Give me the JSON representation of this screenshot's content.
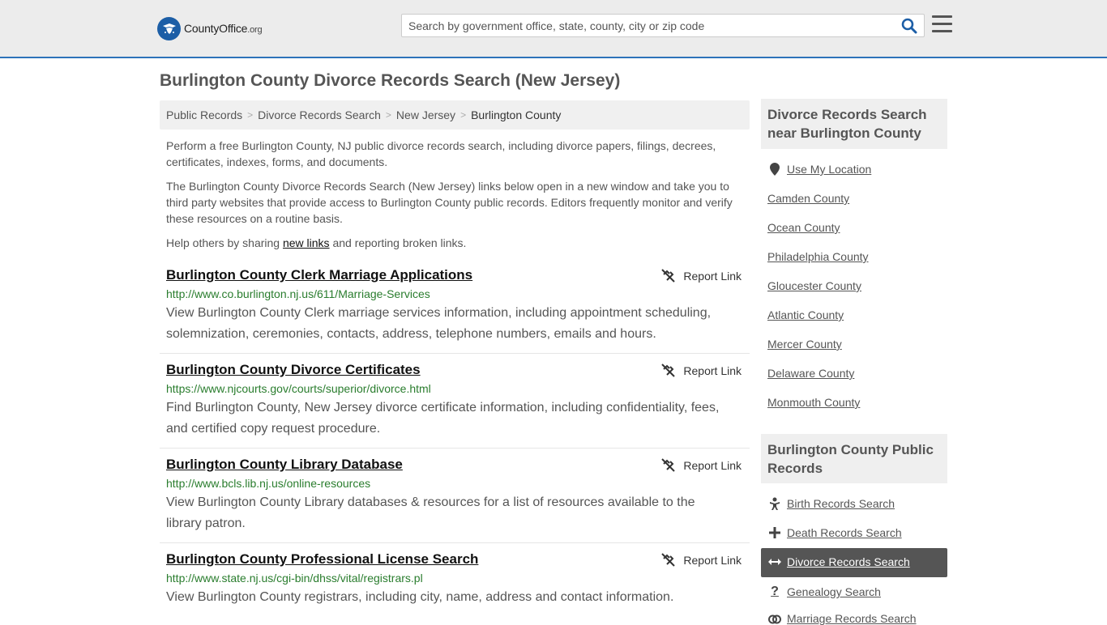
{
  "header": {
    "logo_main": "CountyOffice",
    "logo_suffix": ".org",
    "search_placeholder": "Search by government office, state, county, city or zip code"
  },
  "page_title": "Burlington County Divorce Records Search (New Jersey)",
  "breadcrumb": [
    "Public Records",
    "Divorce Records Search",
    "New Jersey",
    "Burlington County"
  ],
  "intro": {
    "p1": "Perform a free Burlington County, NJ public divorce records search, including divorce papers, filings, decrees, certificates, indexes, forms, and documents.",
    "p2": "The Burlington County Divorce Records Search (New Jersey) links below open in a new window and take you to third party websites that provide access to Burlington County public records. Editors frequently monitor and verify these resources on a routine basis.",
    "p3_before": "Help others by sharing ",
    "p3_link": "new links",
    "p3_after": " and reporting broken links."
  },
  "report_label": "Report Link",
  "results": [
    {
      "title": "Burlington County Clerk Marriage Applications",
      "url": "http://www.co.burlington.nj.us/611/Marriage-Services",
      "desc": "View Burlington County Clerk marriage services information, including appointment scheduling, solemnization, ceremonies, contacts, address, telephone numbers, emails and hours."
    },
    {
      "title": "Burlington County Divorce Certificates",
      "url": "https://www.njcourts.gov/courts/superior/divorce.html",
      "desc": "Find Burlington County, New Jersey divorce certificate information, including confidentiality, fees, and certified copy request procedure."
    },
    {
      "title": "Burlington County Library Database",
      "url": "http://www.bcls.lib.nj.us/online-resources",
      "desc": "View Burlington County Library databases & resources for a list of resources available to the library patron."
    },
    {
      "title": "Burlington County Professional License Search",
      "url": "http://www.state.nj.us/cgi-bin/dhss/vital/registrars.pl",
      "desc": "View Burlington County registrars, including city, name, address and contact information."
    }
  ],
  "sidebar": {
    "nearby_title": "Divorce Records Search near Burlington County",
    "use_location": "Use My Location",
    "nearby": [
      "Camden County",
      "Ocean County",
      "Philadelphia County",
      "Gloucester County",
      "Atlantic County",
      "Mercer County",
      "Delaware County",
      "Monmouth County"
    ],
    "public_title": "Burlington County Public Records",
    "public": [
      {
        "label": "Birth Records Search",
        "icon": "baby-icon"
      },
      {
        "label": "Death Records Search",
        "icon": "cross-icon"
      },
      {
        "label": "Divorce Records Search",
        "icon": "arrows-horizontal-icon",
        "active": true
      },
      {
        "label": "Genealogy Search",
        "icon": "question-icon"
      },
      {
        "label": "Marriage Records Search",
        "icon": "rings-icon"
      }
    ]
  },
  "colors": {
    "accent": "#2d73b9",
    "url_green": "#2a7d2e",
    "active_bg": "#555555"
  }
}
